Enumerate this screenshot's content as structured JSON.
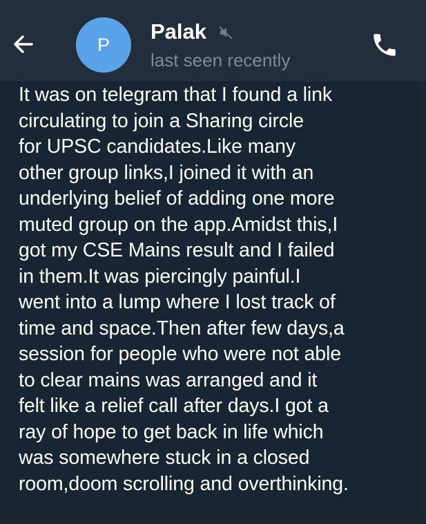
{
  "header": {
    "back_icon": "arrow-left-icon",
    "avatar_letter": "P",
    "avatar_color": "#5aa3e8",
    "contact_name": "Palak",
    "muted_icon": "speaker-muted-icon",
    "status": "last seen recently",
    "call_icon": "phone-icon"
  },
  "message": {
    "text": "It was on telegram that I found a link\ncirculating to join a Sharing circle\nfor UPSC candidates.Like many\nother group links,I joined it with an\nunderlying belief of adding one more\nmuted group on the app.Amidst this,I\ngot my CSE Mains result and I failed\nin them.It was piercingly painful.I\nwent into a lump where I lost track of\ntime and space.Then after few days,a\nsession for people who were not able\nto clear mains was arranged and it\nfelt like a relief call after days.I got a\nray of hope to get back in life which\nwas somewhere stuck in a closed\nroom,doom scrolling and overthinking."
  },
  "colors": {
    "header_background": "#232e3c",
    "chat_background": "#1d2733",
    "bubble_background": "#182533",
    "status_text": "#7d8b99"
  }
}
